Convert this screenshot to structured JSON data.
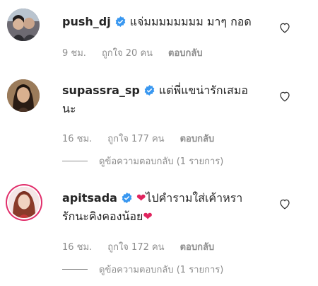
{
  "comments": [
    {
      "username": "push_dj",
      "text_lines": [
        "แจ่มมมมมมมม มาๆ กอด"
      ],
      "time": "9 ชม.",
      "likes": "ถูกใจ 20 คน",
      "reply": "ตอบกลับ"
    },
    {
      "username": "supassra_sp",
      "text_lines": [
        "แต่พี่แขน่ารักเสมอ",
        "นะ"
      ],
      "time": "16 ชม.",
      "likes": "ถูกใจ 177 คน",
      "reply": "ตอบกลับ",
      "view_replies": "ดูข้อความตอบกลับ (1 รายการ)"
    },
    {
      "username": "apitsada",
      "text_lines": [
        "ไปคำรามใส่เค้าหรา",
        "รักนะคิงคองน้อย"
      ],
      "time": "16 ชม.",
      "likes": "ถูกใจ 172 คน",
      "reply": "ตอบกลับ",
      "view_replies": "ดูข้อความตอบกลับ (1 รายการ)"
    }
  ],
  "icons": {
    "verified": "verified-badge-icon",
    "like": "heart-outline-icon",
    "emoji": "red-heart-emoji"
  },
  "colors": {
    "verified": "#3897f0",
    "muted": "#8e8e8e",
    "text": "#262626",
    "heart": "#e0245e"
  }
}
